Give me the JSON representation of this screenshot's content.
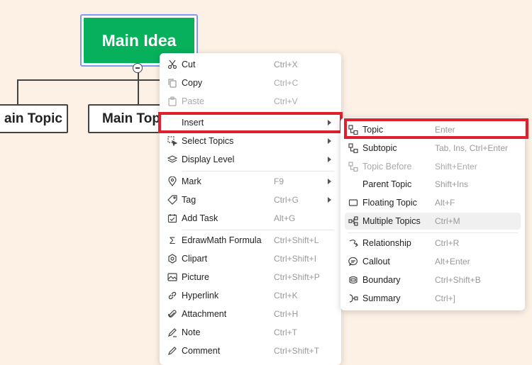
{
  "mindmap": {
    "main_idea": "Main Idea",
    "topics": [
      "ain Topic",
      "Main Topic"
    ]
  },
  "context_menu": {
    "items": [
      {
        "label": "Cut",
        "shortcut": "Ctrl+X",
        "icon": "scissors-icon"
      },
      {
        "label": "Copy",
        "shortcut": "Ctrl+C",
        "icon": "copy-icon"
      },
      {
        "label": "Paste",
        "shortcut": "Ctrl+V",
        "icon": "paste-icon"
      },
      {
        "label": "Insert",
        "shortcut": "",
        "icon": ""
      },
      {
        "label": "Select Topics",
        "shortcut": "",
        "icon": "select-topics-icon"
      },
      {
        "label": "Display Level",
        "shortcut": "",
        "icon": "layers-icon"
      },
      {
        "label": "Mark",
        "shortcut": "F9",
        "icon": "marker-icon"
      },
      {
        "label": "Tag",
        "shortcut": "Ctrl+G",
        "icon": "tag-icon"
      },
      {
        "label": "Add Task",
        "shortcut": "Alt+G",
        "icon": "task-icon"
      },
      {
        "label": "EdrawMath Formula",
        "shortcut": "Ctrl+Shift+L",
        "icon": "sigma-icon"
      },
      {
        "label": "Clipart",
        "shortcut": "Ctrl+Shift+I",
        "icon": "clipart-icon"
      },
      {
        "label": "Picture",
        "shortcut": "Ctrl+Shift+P",
        "icon": "picture-icon"
      },
      {
        "label": "Hyperlink",
        "shortcut": "Ctrl+K",
        "icon": "link-icon"
      },
      {
        "label": "Attachment",
        "shortcut": "Ctrl+H",
        "icon": "paperclip-icon"
      },
      {
        "label": "Note",
        "shortcut": "Ctrl+T",
        "icon": "note-icon"
      },
      {
        "label": "Comment",
        "shortcut": "Ctrl+Shift+T",
        "icon": "comment-icon"
      }
    ]
  },
  "insert_submenu": {
    "items": [
      {
        "label": "Topic",
        "shortcut": "Enter",
        "icon": "topic-icon"
      },
      {
        "label": "Subtopic",
        "shortcut": "Tab, Ins, Ctrl+Enter",
        "icon": "subtopic-icon"
      },
      {
        "label": "Topic Before",
        "shortcut": "Shift+Enter",
        "icon": "topic-before-icon"
      },
      {
        "label": "Parent Topic",
        "shortcut": "Shift+Ins",
        "icon": ""
      },
      {
        "label": "Floating Topic",
        "shortcut": "Alt+F",
        "icon": "floating-topic-icon"
      },
      {
        "label": "Multiple Topics",
        "shortcut": "Ctrl+M",
        "icon": "multiple-topics-icon"
      },
      {
        "label": "Relationship",
        "shortcut": "Ctrl+R",
        "icon": "relationship-icon"
      },
      {
        "label": "Callout",
        "shortcut": "Alt+Enter",
        "icon": "callout-icon"
      },
      {
        "label": "Boundary",
        "shortcut": "Ctrl+Shift+B",
        "icon": "boundary-icon"
      },
      {
        "label": "Summary",
        "shortcut": "Ctrl+]",
        "icon": "summary-icon"
      }
    ]
  },
  "colors": {
    "background": "#fdf1e6",
    "main_idea_fill": "#07b05b",
    "selection_border": "#7e9bf0",
    "highlight_red": "#e0202c"
  }
}
